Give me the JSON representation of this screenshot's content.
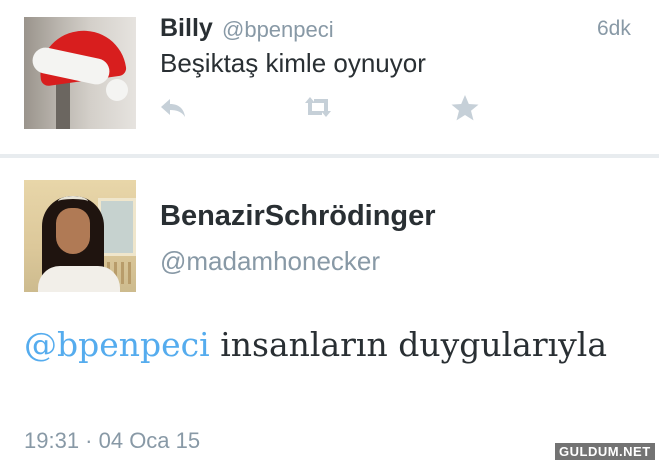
{
  "tweet": {
    "name": "Billy",
    "handle": "@bpenpeci",
    "time": "6dk",
    "text": "Beşiktaş kimle oynuyor",
    "actions": {
      "reply_icon": "reply-icon",
      "retweet_icon": "retweet-icon",
      "favorite_icon": "star-icon"
    }
  },
  "reply": {
    "name": "BenazirSchrödinger",
    "handle": "@madamhonecker",
    "mention": "@bpenpeci",
    "text": " insanların duygularıyla",
    "timestamp": "19:31 · 04 Oca 15"
  },
  "watermark": "GULDUM.NET",
  "colors": {
    "mention": "#55acee",
    "secondary_text": "#8899a6",
    "primary_text": "#292f33",
    "divider": "#e8ecef"
  }
}
